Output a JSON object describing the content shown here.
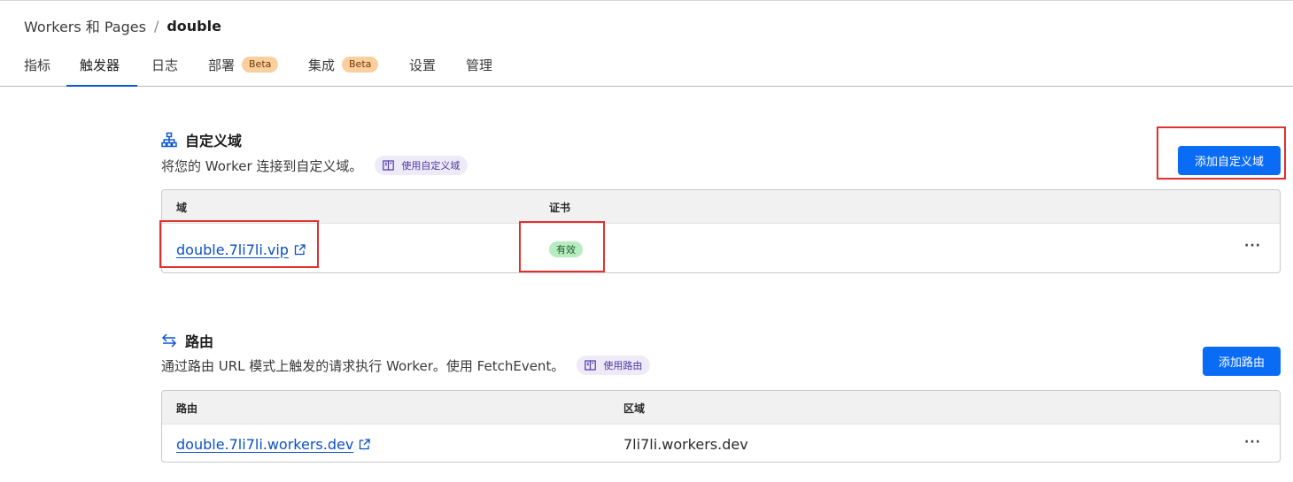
{
  "breadcrumb": {
    "parent": "Workers 和 Pages",
    "separator": "/",
    "current": "double"
  },
  "tabs": [
    {
      "label": "指标",
      "active": false
    },
    {
      "label": "触发器",
      "active": true
    },
    {
      "label": "日志",
      "active": false
    },
    {
      "label": "部署",
      "badge": "Beta",
      "active": false
    },
    {
      "label": "集成",
      "badge": "Beta",
      "active": false
    },
    {
      "label": "设置",
      "active": false
    },
    {
      "label": "管理",
      "active": false
    }
  ],
  "custom_domains": {
    "icon": "sitemap-icon",
    "title": "自定义域",
    "description": "将您的 Worker 连接到自定义域。",
    "doc_link": "使用自定义域",
    "add_button": "添加自定义域",
    "columns": [
      "域",
      "证书"
    ],
    "rows": [
      {
        "domain": "double.7li7li.vip",
        "certificate": "有效",
        "menu": "···"
      }
    ]
  },
  "routes": {
    "icon": "swap-arrows-icon",
    "title": "路由",
    "description": "通过路由 URL 模式上触发的请求执行 Worker。使用 FetchEvent。",
    "doc_link": "使用路由",
    "add_button": "添加路由",
    "columns": [
      "路由",
      "区域"
    ],
    "rows": [
      {
        "route": "double.7li7li.workers.dev",
        "zone": "7li7li.workers.dev",
        "menu": "···"
      }
    ]
  },
  "colors": {
    "accent": "#0a6cf5",
    "link": "#0b4fc4",
    "highlight": "#e03131",
    "beta_badge": "#fbcf9d",
    "valid_badge": "#b7ecc1",
    "doc_pill": "#eeeaf8"
  }
}
